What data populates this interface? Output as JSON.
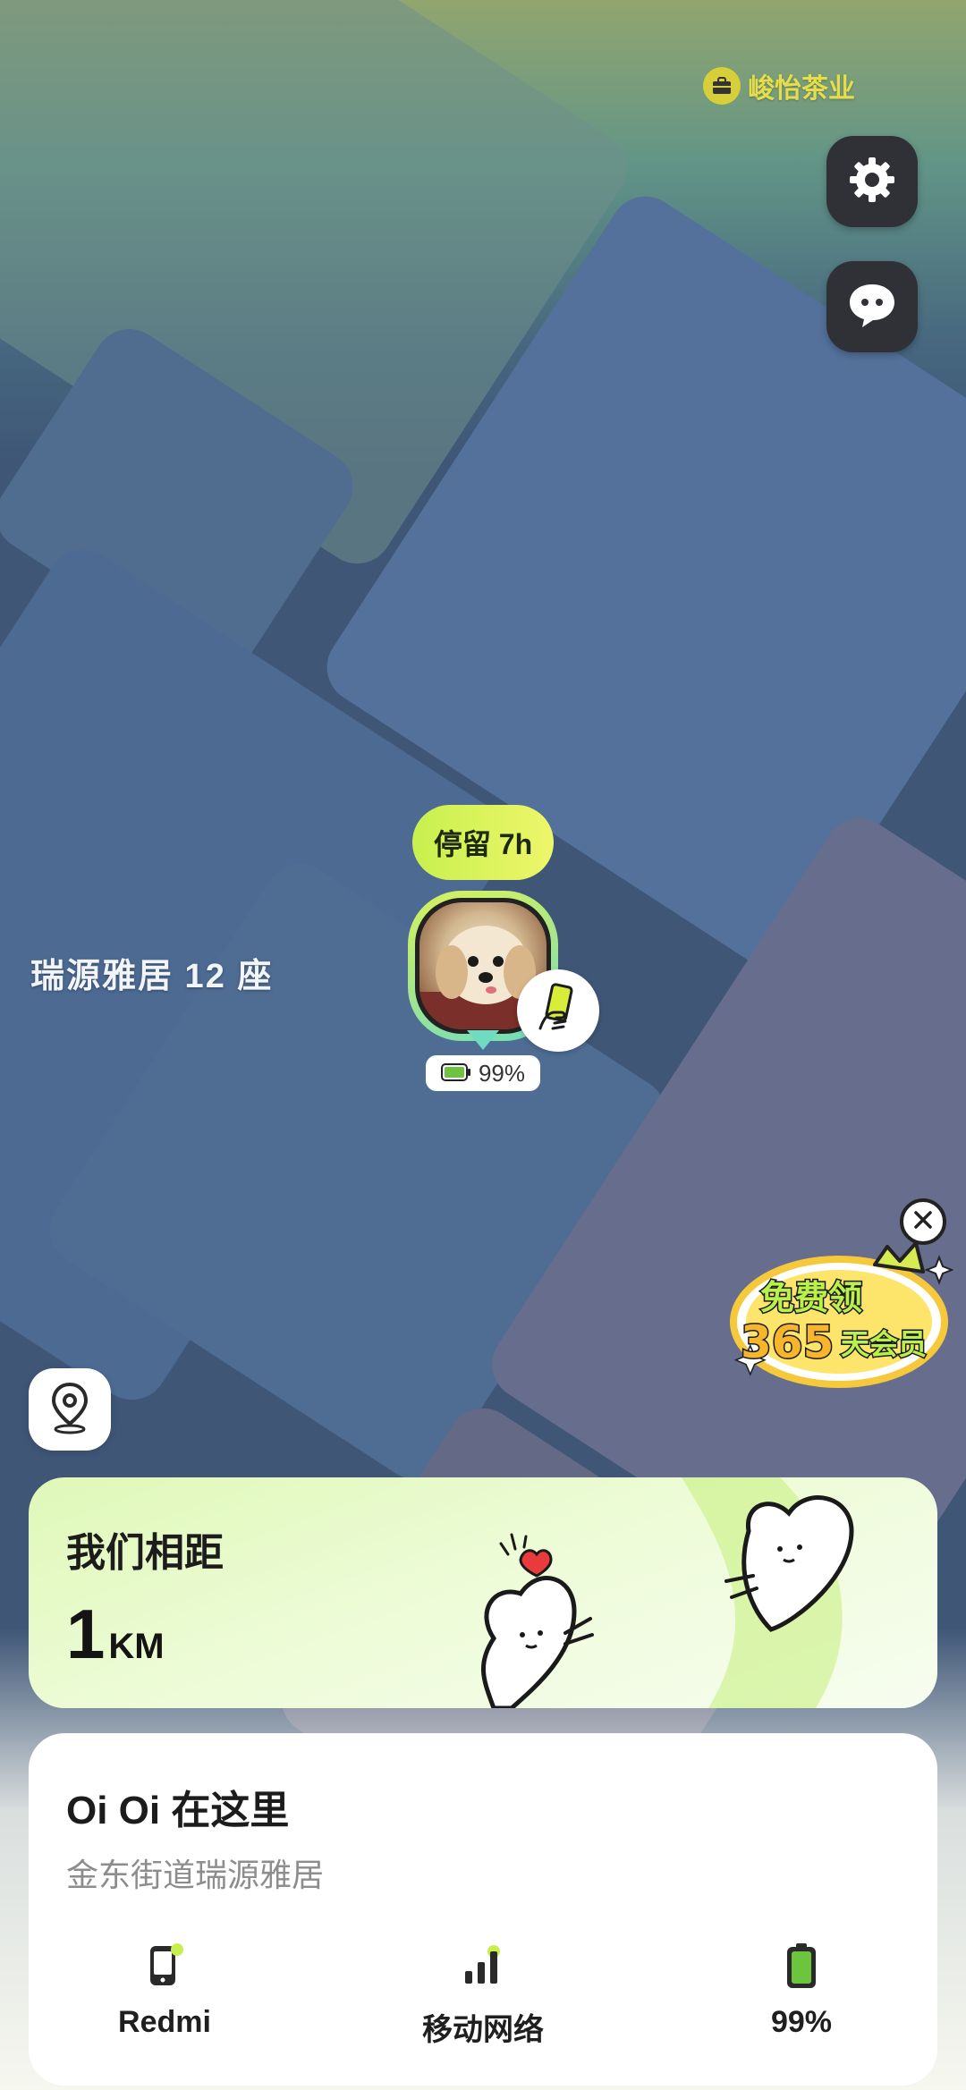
{
  "map": {
    "poi_label": "峻怡茶业",
    "building_label": "瑞源雅居 12 座"
  },
  "controls": {
    "settings_icon": "gear-icon",
    "chat_icon": "chat-bubble-icon",
    "locate_icon": "location-pin-icon"
  },
  "marker": {
    "stay_label": "停留 7h",
    "battery": "99%",
    "device_icon": "hand-holding-phone-icon"
  },
  "promo": {
    "line1": "免费领",
    "line2_number": "365",
    "line2_text": "天会员"
  },
  "distance_card": {
    "title": "我们相距",
    "value": "1",
    "unit": "KM"
  },
  "info_card": {
    "name": "Oi Oi 在这里",
    "address": "金东街道瑞源雅居",
    "stats": [
      {
        "icon": "phone-icon",
        "label": "Redmi"
      },
      {
        "icon": "signal-bars-icon",
        "label": "移动网络"
      },
      {
        "icon": "battery-icon",
        "label": "99%"
      }
    ]
  },
  "colors": {
    "accent_green": "#c7f04e",
    "dark_button": "#2f3136",
    "battery_green": "#6cc43f"
  }
}
